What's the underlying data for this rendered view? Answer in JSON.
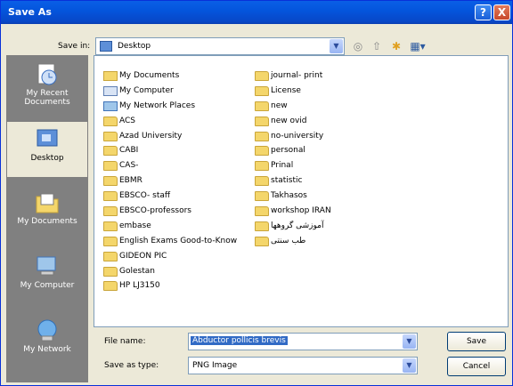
{
  "window": {
    "title": "Save As",
    "help_glyph": "?",
    "close_glyph": "X"
  },
  "toolbar": {
    "save_in_label": "Save in:",
    "save_in_value": "Desktop",
    "icons": [
      "back-icon",
      "up-folder-icon",
      "new-folder-icon",
      "views-menu-icon"
    ]
  },
  "places": [
    {
      "label": "My Recent Documents",
      "icon": "recent-documents-icon"
    },
    {
      "label": "Desktop",
      "icon": "desktop-icon"
    },
    {
      "label": "My Documents",
      "icon": "my-documents-icon"
    },
    {
      "label": "My Computer",
      "icon": "my-computer-icon"
    },
    {
      "label": "My Network",
      "icon": "my-network-icon"
    }
  ],
  "files": {
    "column1": [
      {
        "name": "My Documents",
        "icon": "docs"
      },
      {
        "name": "My Computer",
        "icon": "comp"
      },
      {
        "name": "My Network Places",
        "icon": "net"
      },
      {
        "name": "ACS",
        "icon": "folder"
      },
      {
        "name": "Azad University",
        "icon": "folder"
      },
      {
        "name": "CABI",
        "icon": "folder"
      },
      {
        "name": "CAS-",
        "icon": "folder"
      },
      {
        "name": "EBMR",
        "icon": "folder"
      },
      {
        "name": "EBSCO- staff",
        "icon": "folder"
      },
      {
        "name": "EBSCO-professors",
        "icon": "folder"
      },
      {
        "name": "embase",
        "icon": "folder"
      },
      {
        "name": "English Exams Good-to-Know",
        "icon": "folder"
      },
      {
        "name": "GIDEON PIC",
        "icon": "folder"
      },
      {
        "name": "Golestan",
        "icon": "folder"
      },
      {
        "name": "HP LJ3150",
        "icon": "folder"
      }
    ],
    "column2": [
      {
        "name": "journal- print",
        "icon": "folder"
      },
      {
        "name": "License",
        "icon": "folder"
      },
      {
        "name": "new",
        "icon": "folder"
      },
      {
        "name": "new ovid",
        "icon": "folder"
      },
      {
        "name": "no-university",
        "icon": "folder"
      },
      {
        "name": "personal",
        "icon": "folder"
      },
      {
        "name": "Prinal",
        "icon": "folder"
      },
      {
        "name": "statistic",
        "icon": "folder"
      },
      {
        "name": "Takhasos",
        "icon": "folder"
      },
      {
        "name": "workshop IRAN",
        "icon": "folder"
      },
      {
        "name": "آموزشی گروهها",
        "icon": "folder"
      },
      {
        "name": "طب سنتی",
        "icon": "folder"
      }
    ]
  },
  "form": {
    "file_name_label": "File name:",
    "file_name_value": "Abductor pollicis brevis",
    "save_type_label": "Save as type:",
    "save_type_value": "PNG Image",
    "save_button": "Save",
    "cancel_button": "Cancel"
  },
  "colors": {
    "titlebar": "#0a5fe6",
    "places_bar": "#808080",
    "selection": "#316ac5",
    "dialog_bg": "#ece9d8"
  }
}
